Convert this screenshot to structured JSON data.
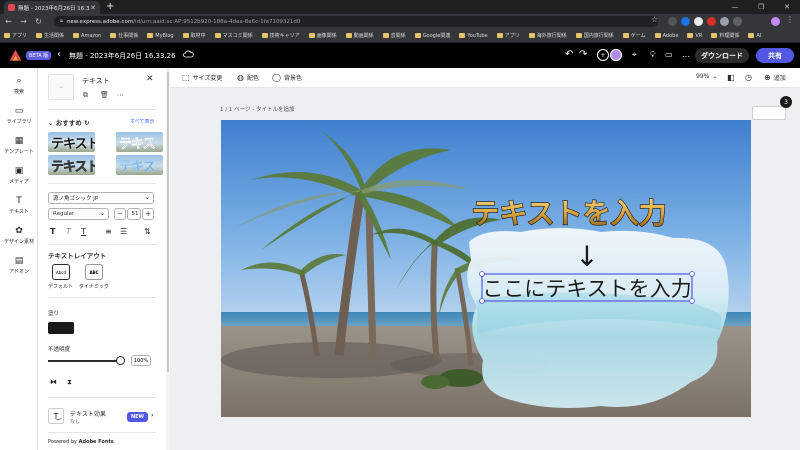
{
  "browser": {
    "tab_title": "無題 - 2023年6月26日 16.33.26",
    "url_host": "new.express.adobe.com",
    "url_path": "/id/urn:aaid:sc:AP:9512b920-188a-4dea-8e6c-1fa7109321d0"
  },
  "bookmarks": [
    "アプリ",
    "生活関係",
    "Amazon",
    "仕事関係",
    "MyBlog",
    "取材中",
    "マスコミ関係",
    "技術キャリア",
    "画像関係",
    "動画関係",
    "音関係",
    "Google関連",
    "YouTube",
    "アプリ",
    "海外旅行関係",
    "国内旅行関係",
    "ゲーム",
    "Adobe",
    "VR",
    "料理関係",
    "AI"
  ],
  "appbar": {
    "beta_label": "BETA 版",
    "doc_title": "無題 - 2023年6月26日 16.33.26",
    "download_label": "ダウンロード",
    "share_label": "共有"
  },
  "rail": [
    {
      "icon": "search-icon",
      "label": "検索"
    },
    {
      "icon": "folder-icon",
      "label": "ライブラリ"
    },
    {
      "icon": "template-icon",
      "label": "テンプレート"
    },
    {
      "icon": "media-icon",
      "label": "メディア"
    },
    {
      "icon": "text-icon",
      "label": "テキスト"
    },
    {
      "icon": "design-assets-icon",
      "label": "デザイン素材"
    },
    {
      "icon": "addon-icon",
      "label": "アドオン"
    }
  ],
  "panel": {
    "title": "テキスト",
    "recommended": "おすすめ",
    "see_all": "すべて表示",
    "presets": [
      {
        "text": "テキスト"
      },
      {
        "text": "テキス"
      },
      {
        "text": "テキスト"
      },
      {
        "text": "テキス"
      }
    ],
    "font_family": "源ノ角ゴシック JP",
    "font_weight": "Regular",
    "font_size": "51",
    "layout_heading": "テキストレイアウト",
    "layout_default": "デフォルト",
    "layout_dynamic": "ダイナミック",
    "layout_default_thumb": "Abcd",
    "layout_dynamic_thumb": "ABC",
    "fill_label": "塗り",
    "fill_color": "#1a1a1a",
    "opacity_label": "不透明度",
    "opacity_value": "100%",
    "opacity_level": 1.0,
    "effect_label": "テキスト効果",
    "effect_sub": "なし",
    "new_badge": "NEW",
    "powered_prefix": "Powered by",
    "powered_brand": "Adobe Fonts"
  },
  "canvas_toolbar": {
    "resize": "サイズ変更",
    "color": "配色",
    "background": "背景色",
    "zoom": "99%",
    "add": "追加"
  },
  "canvas": {
    "page_label": "1 / 1 ページ - タイトルを追加",
    "heading_text": "テキストを入力",
    "arrow_text": "↓",
    "body_text": "ここにテキストを入力",
    "page_count": "3"
  },
  "colors": {
    "accent": "#5258e4",
    "heading_gold": "#d9a441",
    "sky_top": "#3e7fcf"
  }
}
